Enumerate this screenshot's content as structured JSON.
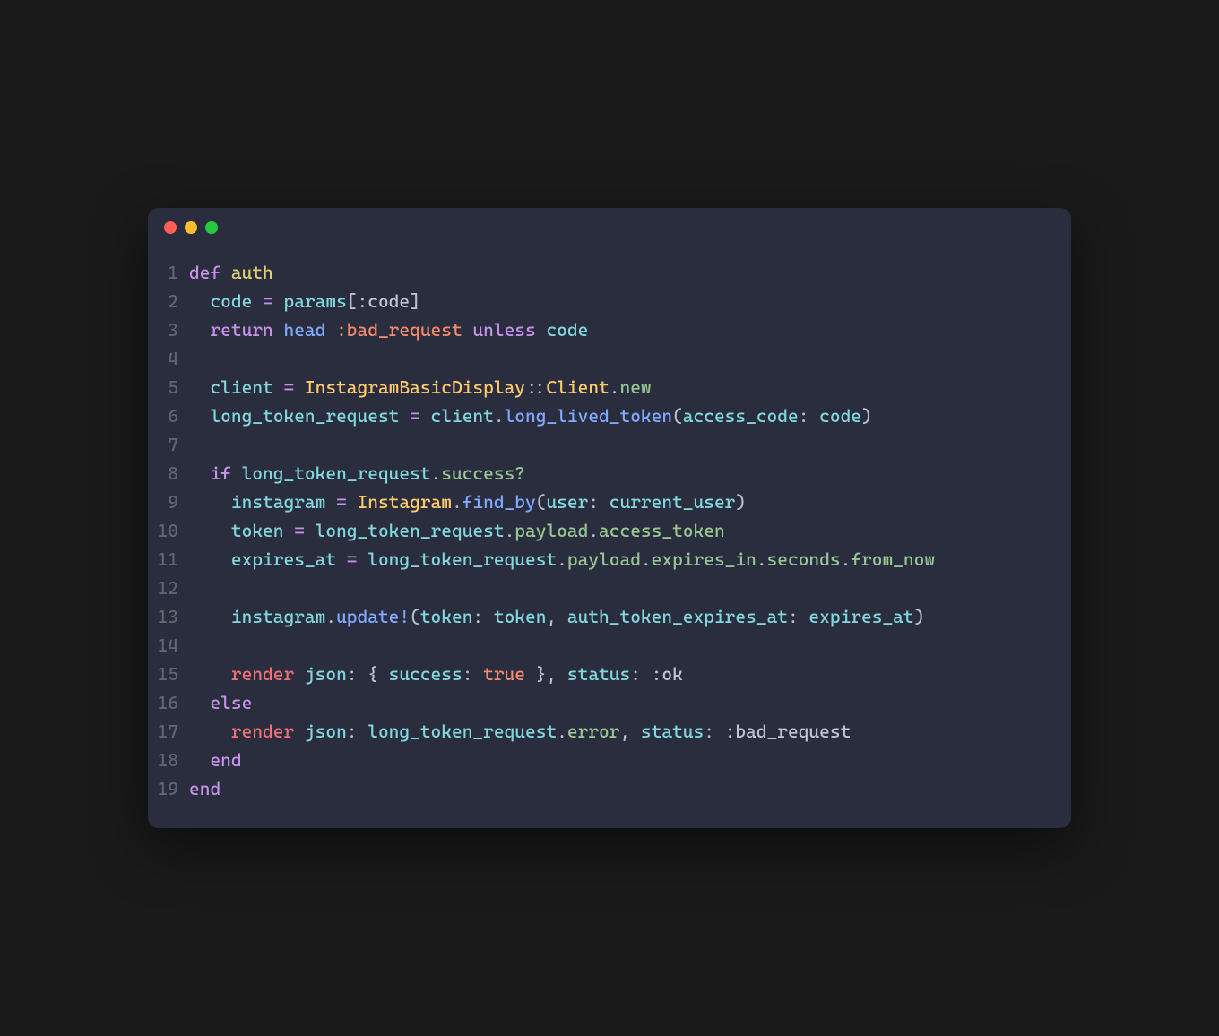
{
  "language": "ruby",
  "window": {
    "traffic_lights": [
      "close",
      "minimize",
      "zoom"
    ]
  },
  "code": {
    "lines": [
      {
        "n": 1,
        "html": "<span class='kw'>def</span> <span class='fn'>auth</span>"
      },
      {
        "n": 2,
        "html": "  <span class='id'>code</span> <span class='op'>=</span> <span class='id'>params</span><span class='punc'>[</span><span class='sym'>:code</span><span class='punc'>]</span>"
      },
      {
        "n": 3,
        "html": "  <span class='kw'>return</span> <span class='call'>head</span> <span class='symc'>:bad_request</span> <span class='kw'>unless</span> <span class='id'>code</span>"
      },
      {
        "n": 4,
        "html": ""
      },
      {
        "n": 5,
        "html": "  <span class='id'>client</span> <span class='op'>=</span> <span class='cls'>InstagramBasicDisplay</span><span class='punc'>::</span><span class='cls'>Client</span><span class='punc'>.</span><span class='prop'>new</span>"
      },
      {
        "n": 6,
        "html": "  <span class='id'>long_token_request</span> <span class='op'>=</span> <span class='id'>client</span><span class='punc'>.</span><span class='call'>long_lived_token</span><span class='punc'>(</span><span class='id'>access_code</span><span class='punc'>:</span> <span class='id'>code</span><span class='punc'>)</span>"
      },
      {
        "n": 7,
        "html": ""
      },
      {
        "n": 8,
        "html": "  <span class='kw'>if</span> <span class='id'>long_token_request</span><span class='punc'>.</span><span class='prop'>success?</span>"
      },
      {
        "n": 9,
        "html": "    <span class='id'>instagram</span> <span class='op'>=</span> <span class='cls'>Instagram</span><span class='punc'>.</span><span class='call'>find_by</span><span class='punc'>(</span><span class='id'>user</span><span class='punc'>:</span> <span class='id'>current_user</span><span class='punc'>)</span>"
      },
      {
        "n": 10,
        "html": "    <span class='id'>token</span> <span class='op'>=</span> <span class='id'>long_token_request</span><span class='punc'>.</span><span class='prop'>payload</span><span class='punc'>.</span><span class='prop'>access_token</span>"
      },
      {
        "n": 11,
        "html": "    <span class='id'>expires_at</span> <span class='op'>=</span> <span class='id'>long_token_request</span><span class='punc'>.</span><span class='prop'>payload</span><span class='punc'>.</span><span class='prop'>expires_in</span><span class='punc'>.</span><span class='prop'>seconds</span><span class='punc'>.</span><span class='prop'>from_now</span>"
      },
      {
        "n": 12,
        "html": ""
      },
      {
        "n": 13,
        "html": "    <span class='id'>instagram</span><span class='punc'>.</span><span class='call'>update!</span><span class='punc'>(</span><span class='id'>token</span><span class='punc'>:</span> <span class='id'>token</span><span class='punc'>,</span> <span class='id'>auth_token_expires_at</span><span class='punc'>:</span> <span class='id'>expires_at</span><span class='punc'>)</span>"
      },
      {
        "n": 14,
        "html": ""
      },
      {
        "n": 15,
        "html": "    <span class='pink'>render</span> <span class='id'>json</span><span class='punc'>:</span> <span class='punc'>{</span> <span class='id'>success</span><span class='punc'>:</span> <span class='num'>true</span> <span class='punc'>},</span> <span class='id'>status</span><span class='punc'>:</span> <span class='sym'>:ok</span>"
      },
      {
        "n": 16,
        "html": "  <span class='kw'>else</span>"
      },
      {
        "n": 17,
        "html": "    <span class='pink'>render</span> <span class='id'>json</span><span class='punc'>:</span> <span class='id'>long_token_request</span><span class='punc'>.</span><span class='prop'>error</span><span class='punc'>,</span> <span class='id'>status</span><span class='punc'>:</span> <span class='sym'>:bad_request</span>"
      },
      {
        "n": 18,
        "html": "  <span class='kw'>end</span>"
      },
      {
        "n": 19,
        "html": "<span class='kw'>end</span>"
      }
    ]
  }
}
